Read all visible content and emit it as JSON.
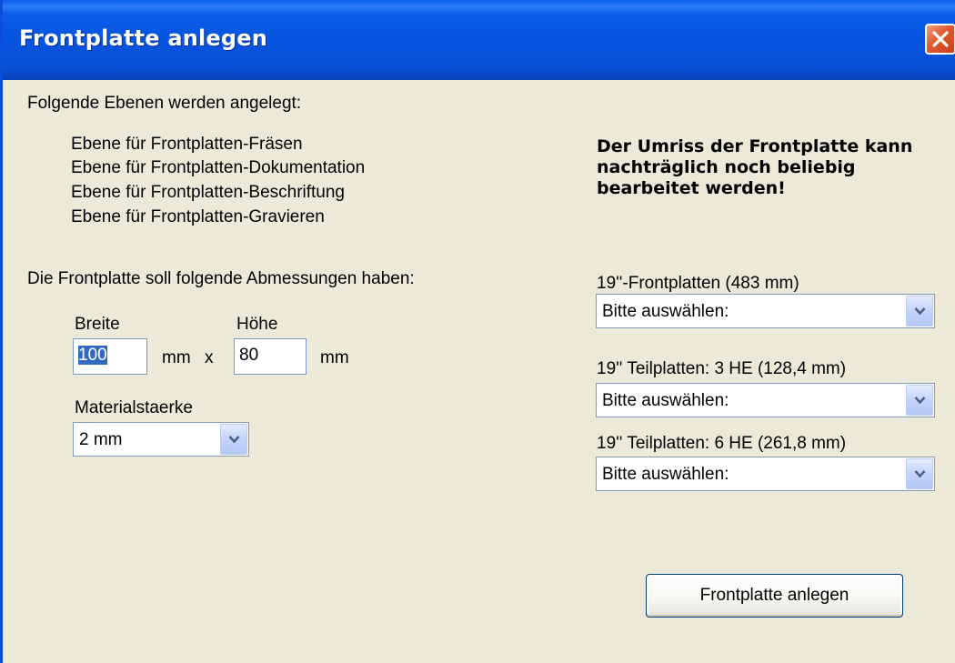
{
  "window": {
    "title": "Frontplatte anlegen"
  },
  "layers": {
    "heading": "Folgende Ebenen werden angelegt:",
    "items": [
      "Ebene für Frontplatten-Fräsen",
      "Ebene für Frontplatten-Dokumentation",
      "Ebene für Frontplatten-Beschriftung",
      "Ebene für Frontplatten-Gravieren"
    ]
  },
  "note": "Der Umriss der Frontplatte kann nachträglich noch beliebig bearbeitet werden!",
  "dimensions": {
    "heading": "Die Frontplatte soll folgende Abmessungen haben:",
    "width_label": "Breite",
    "width_value": "100",
    "unit_mm": "mm",
    "times": "x",
    "height_label": "Höhe",
    "height_value": "80",
    "material_label": "Materialstaerke",
    "material_value": "2 mm"
  },
  "presets": [
    {
      "label": "19''-Frontplatten (483 mm)",
      "value": "Bitte auswählen:"
    },
    {
      "label": "19'' Teilplatten: 3 HE (128,4 mm)",
      "value": "Bitte auswählen:"
    },
    {
      "label": "19'' Teilplatten: 6 HE (261,8 mm)",
      "value": "Bitte auswählen:"
    }
  ],
  "actions": {
    "create_label": "Frontplatte anlegen"
  },
  "colors": {
    "titlebar": "#0654e0",
    "background": "#ece9d8",
    "selection": "#316ac5"
  }
}
